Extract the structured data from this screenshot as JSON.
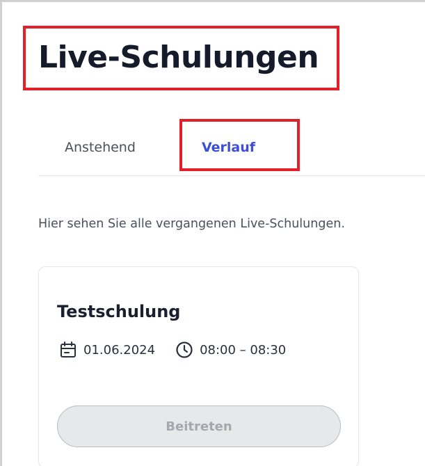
{
  "page": {
    "title": "Live-Schulungen"
  },
  "tabs": [
    {
      "label": "Anstehend",
      "active": false
    },
    {
      "label": "Verlauf",
      "active": true
    }
  ],
  "intro": "Hier sehen Sie alle vergangenen Live-Schulungen.",
  "sessions": [
    {
      "title": "Testschulung",
      "date": "01.06.2024",
      "time": "08:00 – 08:30",
      "join_label": "Beitreten",
      "join_enabled": false,
      "date_icon": "calendar-icon",
      "time_icon": "clock-icon"
    }
  ],
  "colors": {
    "accent": "#3c4fd6",
    "highlight": "#e3202a",
    "title": "#161b2c",
    "button_bg": "#e7e8ea",
    "button_text": "#a4a7ae"
  }
}
